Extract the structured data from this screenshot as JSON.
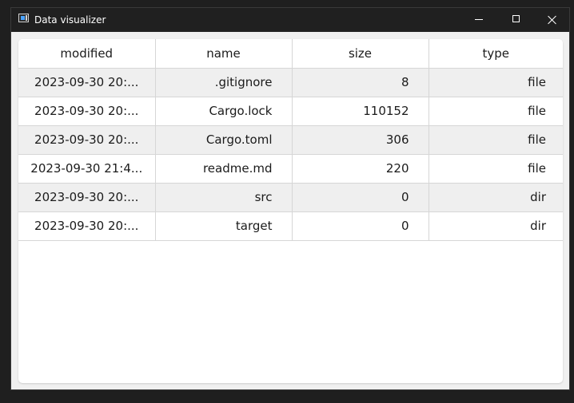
{
  "window": {
    "title": "Data visualizer"
  },
  "table": {
    "columns": {
      "modified": "modified",
      "name": "name",
      "size": "size",
      "type": "type"
    },
    "rows": [
      {
        "modified": "2023-09-30 20:...",
        "name": ".gitignore",
        "size": "8",
        "type": "file"
      },
      {
        "modified": "2023-09-30 20:...",
        "name": "Cargo.lock",
        "size": "110152",
        "type": "file"
      },
      {
        "modified": "2023-09-30 20:...",
        "name": "Cargo.toml",
        "size": "306",
        "type": "file"
      },
      {
        "modified": "2023-09-30 21:4...",
        "name": "readme.md",
        "size": "220",
        "type": "file"
      },
      {
        "modified": "2023-09-30 20:...",
        "name": "src",
        "size": "0",
        "type": "dir"
      },
      {
        "modified": "2023-09-30 20:...",
        "name": "target",
        "size": "0",
        "type": "dir"
      }
    ]
  }
}
